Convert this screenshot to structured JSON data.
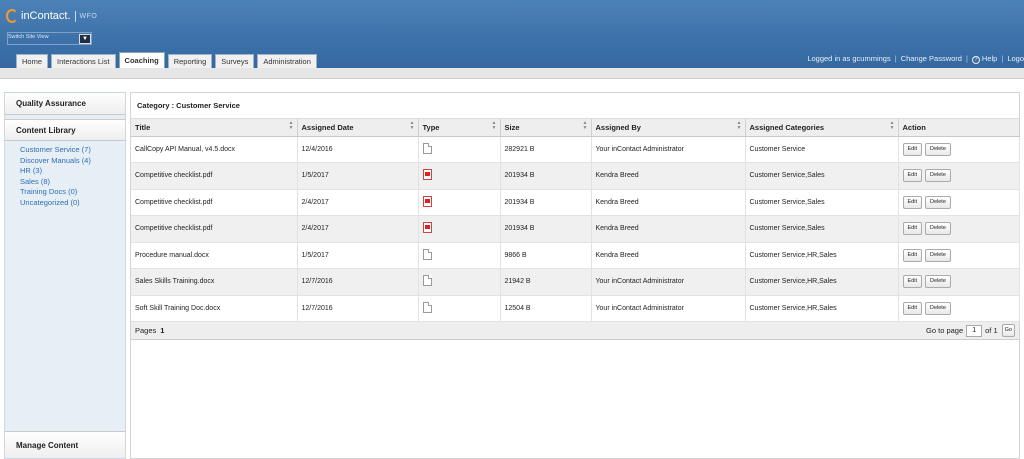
{
  "app": {
    "brand": "inContact.",
    "product": "WFO",
    "site_switch_label": "Switch Site View"
  },
  "tabs": [
    "Home",
    "Interactions List",
    "Coaching",
    "Reporting",
    "Surveys",
    "Administration"
  ],
  "active_tab": "Coaching",
  "userbar": {
    "logged_in": "Logged in as gcummings",
    "change_password": "Change Password",
    "help": "Help",
    "logout": "Logo"
  },
  "sidebar": {
    "quality": "Quality Assurance",
    "library": "Content Library",
    "items": [
      {
        "label": "Customer Service (7)"
      },
      {
        "label": "Discover Manuals (4)"
      },
      {
        "label": "HR (3)"
      },
      {
        "label": "Sales (8)"
      },
      {
        "label": "Training Docs (0)"
      },
      {
        "label": "Uncategorized (0)"
      }
    ],
    "manage": "Manage Content"
  },
  "main": {
    "category": "Category : Customer Service",
    "columns": [
      "Title",
      "Assigned Date",
      "Type",
      "Size",
      "Assigned By",
      "Assigned Categories",
      "Action"
    ],
    "rows": [
      {
        "title": "CallCopy API Manual, v4.5.docx",
        "date": "12/4/2016",
        "type": "doc-icon",
        "size": "282921 B",
        "by": "Your inContact Administrator",
        "cats": "Customer Service"
      },
      {
        "title": "Competitive checklist.pdf",
        "date": "1/5/2017",
        "type": "pdf-icon",
        "size": "201934 B",
        "by": "Kendra Breed",
        "cats": "Customer Service,Sales"
      },
      {
        "title": "Competitive checklist.pdf",
        "date": "2/4/2017",
        "type": "pdf-icon",
        "size": "201934 B",
        "by": "Kendra Breed",
        "cats": "Customer Service,Sales"
      },
      {
        "title": "Competitive checklist.pdf",
        "date": "2/4/2017",
        "type": "pdf-icon",
        "size": "201934 B",
        "by": "Kendra Breed",
        "cats": "Customer Service,Sales"
      },
      {
        "title": "Procedure manual.docx",
        "date": "1/5/2017",
        "type": "doc-icon",
        "size": "9866 B",
        "by": "Kendra Breed",
        "cats": "Customer Service,HR,Sales"
      },
      {
        "title": "Sales Skills Training.docx",
        "date": "12/7/2016",
        "type": "doc-icon",
        "size": "21942 B",
        "by": "Your inContact Administrator",
        "cats": "Customer Service,HR,Sales"
      },
      {
        "title": "Soft Skill Training Doc.docx",
        "date": "12/7/2016",
        "type": "doc-icon",
        "size": "12504 B",
        "by": "Your inContact Administrator",
        "cats": "Customer Service,HR,Sales"
      }
    ],
    "edit_label": "Edit",
    "delete_label": "Delete",
    "pager": {
      "pages_label": "Pages",
      "current": "1",
      "go_to_label": "Go to page",
      "of_label": "of 1",
      "go_label": "Go"
    }
  }
}
